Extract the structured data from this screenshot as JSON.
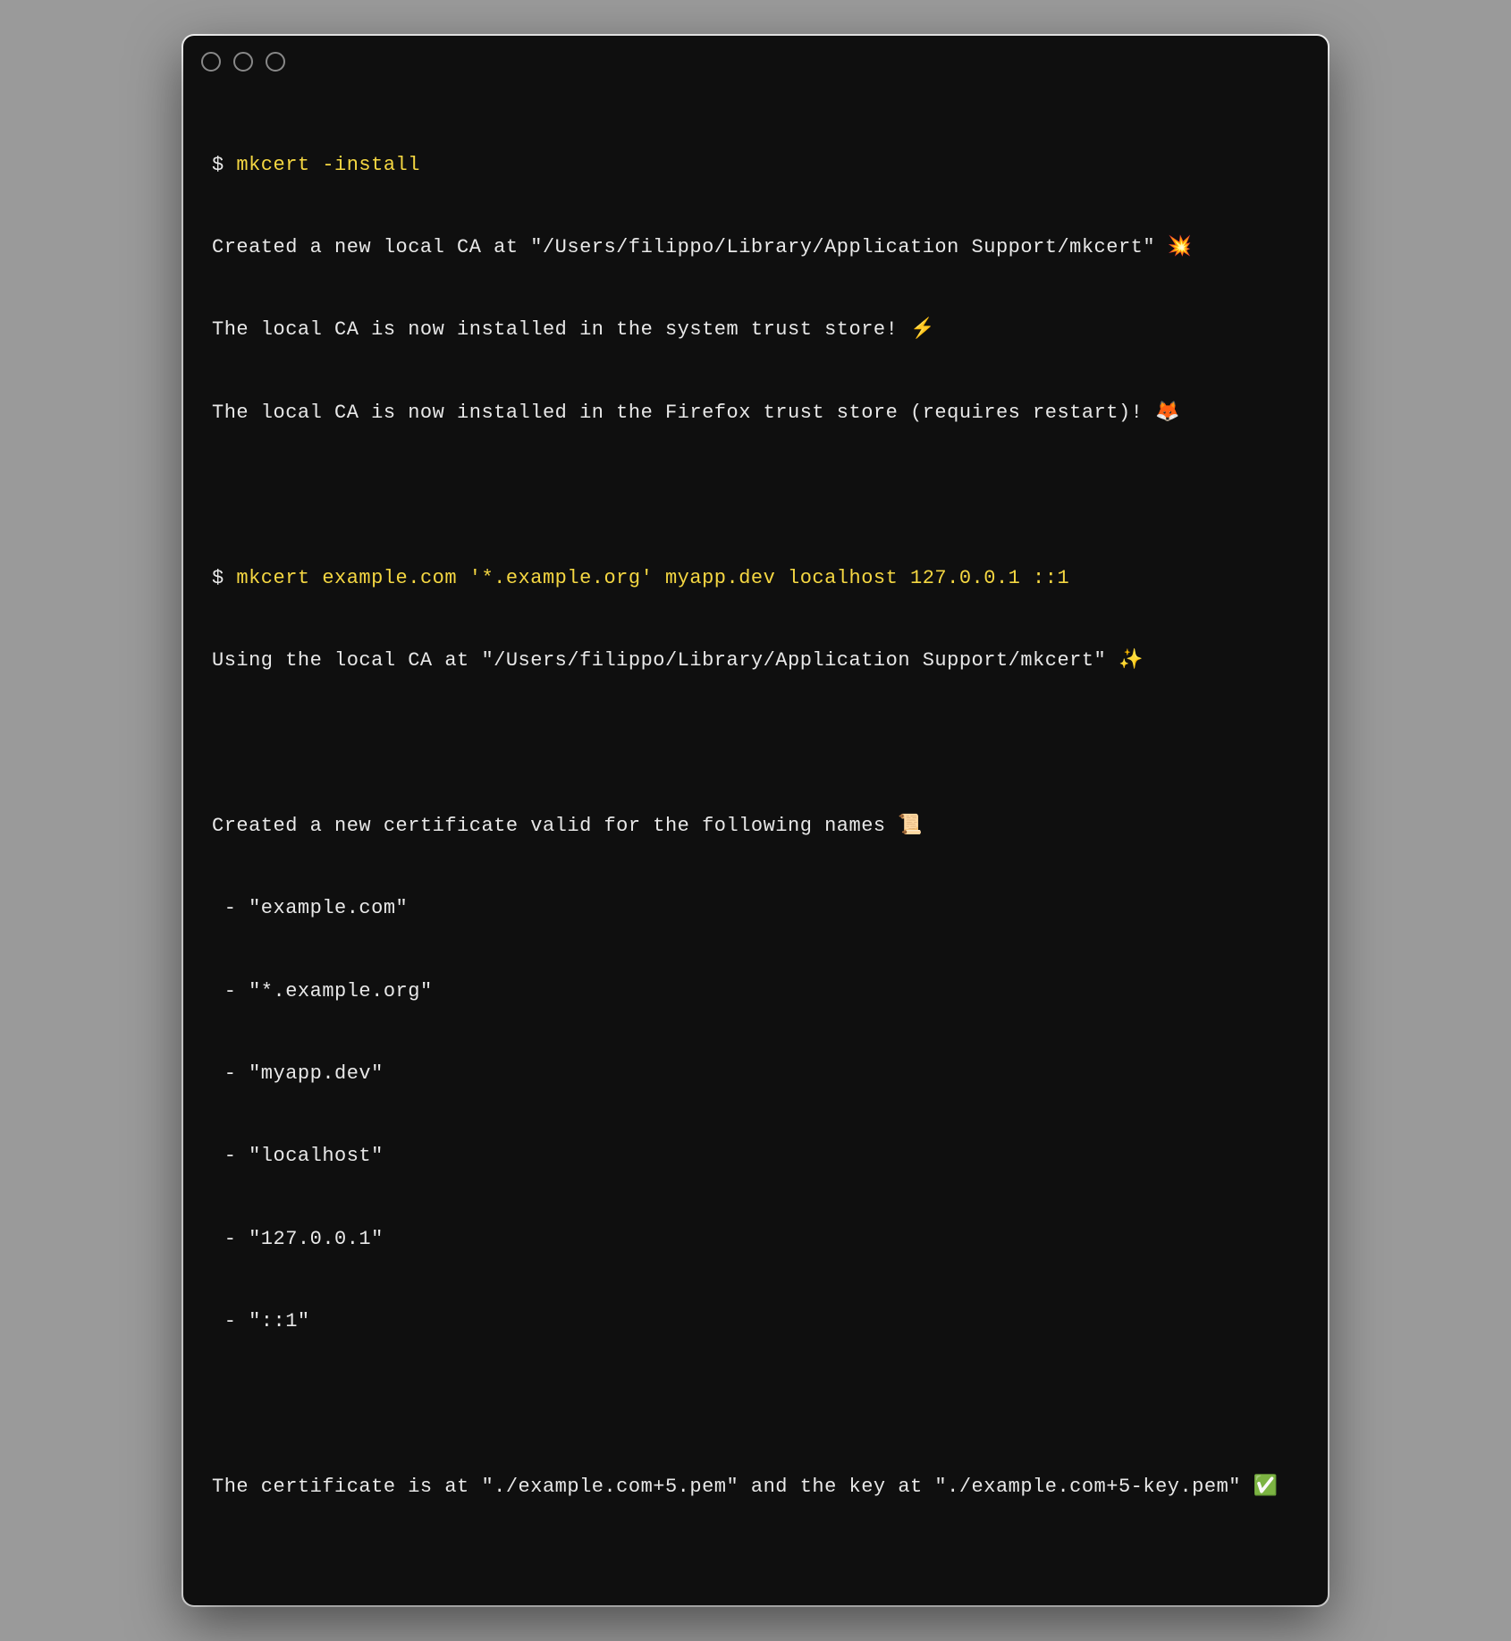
{
  "terminal": {
    "prompt1": "$ ",
    "command1": "mkcert -install",
    "output1_line1": "Created a new local CA at \"/Users/filippo/Library/Application Support/mkcert\" 💥",
    "output1_line2": "The local CA is now installed in the system trust store! ⚡️",
    "output1_line3": "The local CA is now installed in the Firefox trust store (requires restart)! 🦊",
    "prompt2": "$ ",
    "command2": "mkcert example.com '*.example.org' myapp.dev localhost 127.0.0.1 ::1",
    "output2_line1": "Using the local CA at \"/Users/filippo/Library/Application Support/mkcert\" ✨",
    "output2_line2": "Created a new certificate valid for the following names 📜",
    "output2_name1": " - \"example.com\"",
    "output2_name2": " - \"*.example.org\"",
    "output2_name3": " - \"myapp.dev\"",
    "output2_name4": " - \"localhost\"",
    "output2_name5": " - \"127.0.0.1\"",
    "output2_name6": " - \"::1\"",
    "output2_result": "The certificate is at \"./example.com+5.pem\" and the key at \"./example.com+5-key.pem\" ✅"
  }
}
